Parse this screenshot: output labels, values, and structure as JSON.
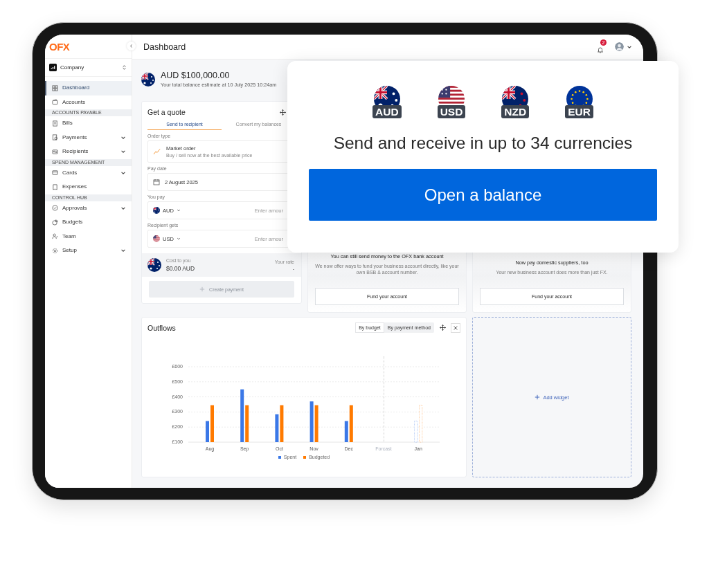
{
  "app": {
    "logo": "OFX"
  },
  "sidebar": {
    "org": "Company",
    "items": [
      {
        "kind": "link",
        "label": "Dashboard",
        "selected": true,
        "expandable": false
      },
      {
        "kind": "link",
        "label": "Accounts",
        "selected": false,
        "expandable": false
      },
      {
        "kind": "section",
        "label": "ACCOUNTS PAYABLE"
      },
      {
        "kind": "link",
        "label": "Bills",
        "selected": false,
        "expandable": false
      },
      {
        "kind": "link",
        "label": "Payments",
        "selected": false,
        "expandable": true
      },
      {
        "kind": "link",
        "label": "Recipients",
        "selected": false,
        "expandable": true
      },
      {
        "kind": "section",
        "label": "SPEND MANAGEMENT"
      },
      {
        "kind": "link",
        "label": "Cards",
        "selected": false,
        "expandable": true
      },
      {
        "kind": "link",
        "label": "Expenses",
        "selected": false,
        "expandable": false
      },
      {
        "kind": "section",
        "label": "CONTROL HUB"
      },
      {
        "kind": "link",
        "label": "Approvals",
        "selected": false,
        "expandable": true
      },
      {
        "kind": "link",
        "label": "Budgets",
        "selected": false,
        "expandable": false
      },
      {
        "kind": "link",
        "label": "Team",
        "selected": false,
        "expandable": false
      },
      {
        "kind": "link",
        "label": "Setup",
        "selected": false,
        "expandable": true
      }
    ]
  },
  "header": {
    "title": "Dashboard",
    "notifications": "2"
  },
  "balance": {
    "amount": "AUD $100,000.00",
    "caption": "Your total balance estimate at 10 July 2025 10:24am"
  },
  "quote": {
    "title": "Get a quote",
    "tabs": [
      {
        "label": "Send to recipient",
        "selected": true
      },
      {
        "label": "Convert my balances",
        "selected": false
      }
    ],
    "order_type": {
      "label": "Order type",
      "value": "Market order",
      "hint": "Buy / sell now at the best available price"
    },
    "pay_date": {
      "label": "Pay date",
      "value": "2 August 2025"
    },
    "you_pay": {
      "label": "You pay",
      "currency": "AUD",
      "placeholder": "Enter amour"
    },
    "recipient_gets": {
      "label": "Recipient gets",
      "currency": "USD",
      "placeholder": "Enter amour"
    },
    "cost": {
      "label": "Cost to you",
      "value": "$0.00 AUD",
      "rate_label": "Your rate",
      "rate_value": "-"
    },
    "create_button": {
      "label": "Create payment",
      "disabled": true
    }
  },
  "promos": [
    {
      "title": "You can still send money to the OFX bank account",
      "text": "We now offer ways to fund your business account directly, like your own BSB & account number.",
      "button": "Fund your account"
    },
    {
      "title": "Now pay domestic suppliers, too",
      "text": "Your new business account does more than just FX.",
      "button": "Fund your account"
    }
  ],
  "outflows": {
    "title": "Outflows",
    "views": [
      {
        "label": "By budget",
        "selected": true
      },
      {
        "label": "By payment method",
        "selected": false
      }
    ],
    "chart_data": {
      "type": "bar",
      "categories": [
        "Aug",
        "Sep",
        "Oct",
        "Nov",
        "Dec",
        "Forcast",
        "Jan"
      ],
      "series": [
        {
          "name": "Spent",
          "color": "#3b78e7",
          "values": [
            240,
            450,
            285,
            370,
            240,
            null,
            240
          ]
        },
        {
          "name": "Budgeted",
          "color": "#ff7a00",
          "values": [
            345,
            345,
            345,
            345,
            345,
            null,
            345
          ]
        }
      ],
      "ylim": [
        100,
        600
      ],
      "yticks": [
        {
          "value": 100,
          "label": "£100"
        },
        {
          "value": 200,
          "label": "£200"
        },
        {
          "value": 300,
          "label": "£300"
        },
        {
          "value": 400,
          "label": "£400"
        },
        {
          "value": 500,
          "label": "£500"
        },
        {
          "value": 600,
          "label": "£600"
        }
      ],
      "grid": true,
      "legend": true,
      "ref_lines": [
        {
          "axis": "x",
          "value": "Forcast"
        }
      ]
    }
  },
  "add_widget": {
    "label": "Add widget"
  },
  "overlay": {
    "currencies": [
      {
        "code": "AUD"
      },
      {
        "code": "USD"
      },
      {
        "code": "NZD"
      },
      {
        "code": "EUR"
      }
    ],
    "headline": "Send and receive in up to 34 currencies",
    "button": "Open a balance"
  }
}
